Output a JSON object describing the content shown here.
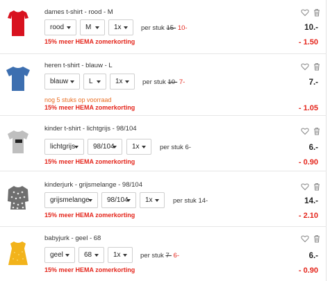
{
  "items": [
    {
      "name": "dames t-shirt - rood - M",
      "color": "rood",
      "size": "M",
      "qty": "1x",
      "per_stuk_label": "per stuk",
      "old_price": "15-",
      "new_price": "10-",
      "total": "10.-",
      "discount": "- 1.50",
      "promo": "15% meer HEMA zomerkorting",
      "stock_note": "",
      "image": "red-womens-tshirt"
    },
    {
      "name": "heren t-shirt - blauw - L",
      "color": "blauw",
      "size": "L",
      "qty": "1x",
      "per_stuk_label": "per stuk",
      "old_price": "10-",
      "new_price": "7-",
      "total": "7.-",
      "discount": "- 1.05",
      "promo": "15% meer HEMA zomerkorting",
      "stock_note": "nog 5 stuks op voorraad",
      "image": "blue-mens-tshirt"
    },
    {
      "name": "kinder t-shirt - lichtgrijs - 98/104",
      "color": "lichtgrijs",
      "size": "98/104",
      "qty": "1x",
      "per_stuk_label": "per stuk",
      "old_price": "",
      "new_price": "6-",
      "total": "6.-",
      "discount": "- 0.90",
      "promo": "15% meer HEMA zomerkorting",
      "stock_note": "",
      "image": "grey-kids-tshirt"
    },
    {
      "name": "kinderjurk - grijsmelange - 98/104",
      "color": "grijsmelange",
      "size": "98/104",
      "qty": "1x",
      "per_stuk_label": "per stuk",
      "old_price": "",
      "new_price": "14-",
      "total": "14.-",
      "discount": "- 2.10",
      "promo": "15% meer HEMA zomerkorting",
      "stock_note": "",
      "image": "grey-kids-dress"
    },
    {
      "name": "babyjurk - geel - 68",
      "color": "geel",
      "size": "68",
      "qty": "1x",
      "per_stuk_label": "per stuk",
      "old_price": "7-",
      "new_price": "6-",
      "total": "6.-",
      "discount": "- 0.90",
      "promo": "15% meer HEMA zomerkorting",
      "stock_note": "",
      "image": "yellow-baby-dress"
    }
  ],
  "colors": {
    "accent_red": "#e4251b",
    "stock_orange": "#e96d22"
  },
  "icons": {
    "favorite": "heart-icon",
    "remove": "trash-icon",
    "dropdown": "chevron-down-icon"
  }
}
